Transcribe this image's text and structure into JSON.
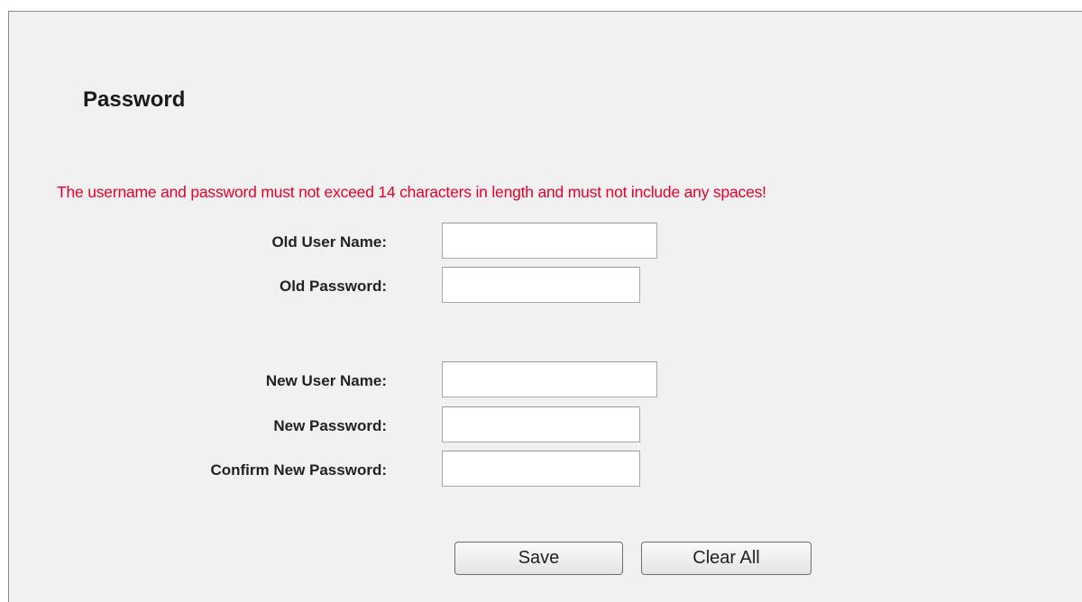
{
  "page": {
    "title": "Password",
    "warning": "The username and password must not exceed 14 characters in length and must not include any spaces!"
  },
  "form": {
    "old_user_name": {
      "label": "Old User Name:",
      "value": ""
    },
    "old_password": {
      "label": "Old Password:",
      "value": ""
    },
    "new_user_name": {
      "label": "New User Name:",
      "value": ""
    },
    "new_password": {
      "label": "New Password:",
      "value": ""
    },
    "confirm_new_password": {
      "label": "Confirm New Password:",
      "value": ""
    }
  },
  "buttons": {
    "save": "Save",
    "clear_all": "Clear All"
  },
  "colors": {
    "warning": "#e6002a",
    "panel_background": "#f1f1f1"
  }
}
